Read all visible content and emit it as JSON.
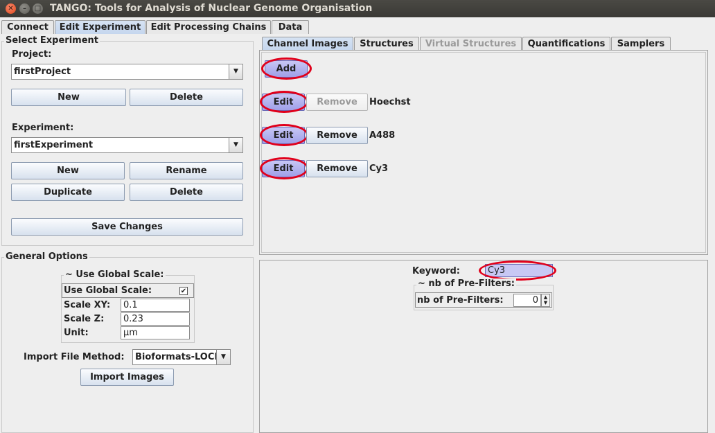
{
  "window": {
    "title": "TANGO: Tools for Analysis of Nuclear Genome Organisation"
  },
  "main_tabs": [
    {
      "label": "Connect"
    },
    {
      "label": "Edit Experiment"
    },
    {
      "label": "Edit Processing Chains"
    },
    {
      "label": "Data"
    }
  ],
  "select_experiment": {
    "legend": "Select Experiment",
    "project_label": "Project:",
    "project_value": "firstProject",
    "project_new": "New",
    "project_delete": "Delete",
    "experiment_label": "Experiment:",
    "experiment_value": "firstExperiment",
    "exp_new": "New",
    "exp_rename": "Rename",
    "exp_duplicate": "Duplicate",
    "exp_delete": "Delete",
    "save_changes": "Save Changes"
  },
  "general_options": {
    "legend": "General Options",
    "global_scale_legend": "~ Use Global Scale:",
    "use_global_scale_label": "Use Global Scale:",
    "use_global_scale_checked": "✔",
    "scale_xy_label": "Scale XY:",
    "scale_xy_value": "0.1",
    "scale_z_label": "Scale Z:",
    "scale_z_value": "0.23",
    "unit_label": "Unit:",
    "unit_value": "µm",
    "import_method_label": "Import File Method:",
    "import_method_value": "Bioformats-LOCI",
    "import_images": "Import Images"
  },
  "sub_tabs": [
    {
      "label": "Channel Images"
    },
    {
      "label": "Structures"
    },
    {
      "label": "Virtual Structures"
    },
    {
      "label": "Quantifications"
    },
    {
      "label": "Samplers"
    }
  ],
  "channels": {
    "add_label": "Add",
    "edit_label": "Edit",
    "remove_label": "Remove",
    "items": [
      {
        "name": "Hoechst"
      },
      {
        "name": "A488"
      },
      {
        "name": "Cy3"
      }
    ]
  },
  "channel_detail": {
    "keyword_label": "Keyword:",
    "keyword_value": "Cy3",
    "prefilters_legend": "~ nb of Pre-Filters:",
    "prefilters_label": "nb of Pre-Filters:",
    "prefilters_value": "0"
  },
  "colors": {
    "highlight_ring": "#e0001b",
    "highlight_button": "#a8a8ec",
    "accent_tab": "#c5d6ee"
  }
}
